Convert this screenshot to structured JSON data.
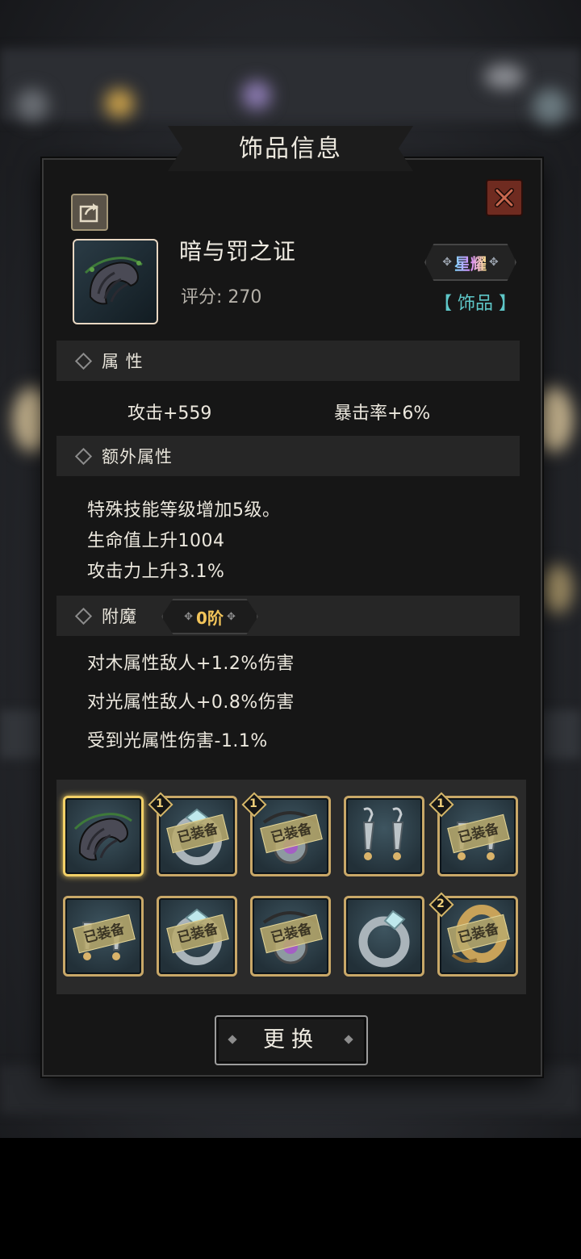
{
  "dialog": {
    "title": "饰品信息",
    "share_icon": "share-icon",
    "close_icon": "close-icon"
  },
  "item": {
    "name": "暗与罚之证",
    "score_label": "评分: 270",
    "rarity": "星耀",
    "type": "【 饰品 】"
  },
  "sections": {
    "attributes": "属 性",
    "extra_attributes": "额外属性",
    "enchant": "附魔"
  },
  "attributes": {
    "attack": "攻击+559",
    "crit": "暴击率+6%"
  },
  "extra_attributes": [
    "特殊技能等级增加5级。",
    "生命值上升1004",
    "攻击力上升3.1%"
  ],
  "enchant": {
    "tier": "0阶",
    "effects": [
      "对木属性敌人+1.2%伤害",
      "对光属性敌人+0.8%伤害",
      "受到光属性伤害-1.1%"
    ]
  },
  "gallery": {
    "equipped_label": "已装备",
    "slots": [
      {
        "icon": "horn-accessory-icon",
        "selected": true,
        "equipped": false,
        "badge": ""
      },
      {
        "icon": "crystal-ring-icon",
        "selected": false,
        "equipped": true,
        "badge": "1"
      },
      {
        "icon": "amulet-icon",
        "selected": false,
        "equipped": true,
        "badge": "1"
      },
      {
        "icon": "earrings-icon",
        "selected": false,
        "equipped": false,
        "badge": ""
      },
      {
        "icon": "earrings-icon",
        "selected": false,
        "equipped": true,
        "badge": "1"
      },
      {
        "icon": "earrings-icon",
        "selected": false,
        "equipped": true,
        "badge": ""
      },
      {
        "icon": "crystal-ring-icon",
        "selected": false,
        "equipped": true,
        "badge": ""
      },
      {
        "icon": "amulet-icon",
        "selected": false,
        "equipped": true,
        "badge": ""
      },
      {
        "icon": "crystal-ring-icon",
        "selected": false,
        "equipped": false,
        "badge": ""
      },
      {
        "icon": "gold-bracelet-icon",
        "selected": false,
        "equipped": true,
        "badge": "2"
      }
    ]
  },
  "actions": {
    "replace": "更换"
  }
}
